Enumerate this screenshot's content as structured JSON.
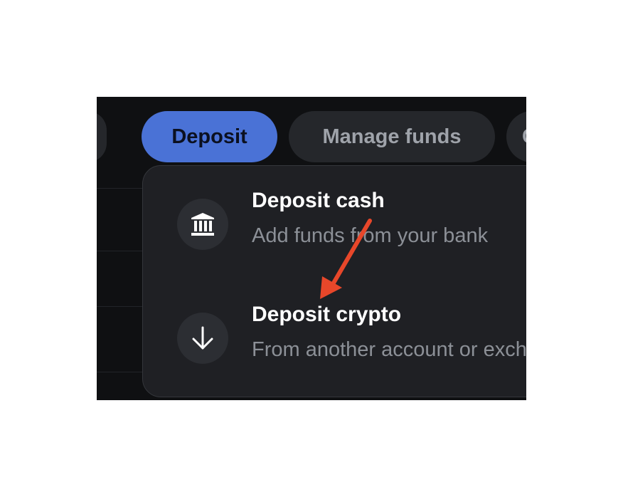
{
  "tabs": {
    "deposit_label": "Deposit",
    "manage_label": "Manage funds",
    "partial_right_label": "C"
  },
  "menu": {
    "items": [
      {
        "title": "Deposit cash",
        "subtitle": "Add funds from your bank",
        "icon": "bank-icon"
      },
      {
        "title": "Deposit crypto",
        "subtitle": "From another account or exchange",
        "icon": "arrow-down-icon"
      }
    ]
  },
  "colors": {
    "background": "#0f1012",
    "deposit_button": "#4a72d6",
    "menu_background": "#1f2024",
    "annotation_arrow": "#e8472a"
  }
}
